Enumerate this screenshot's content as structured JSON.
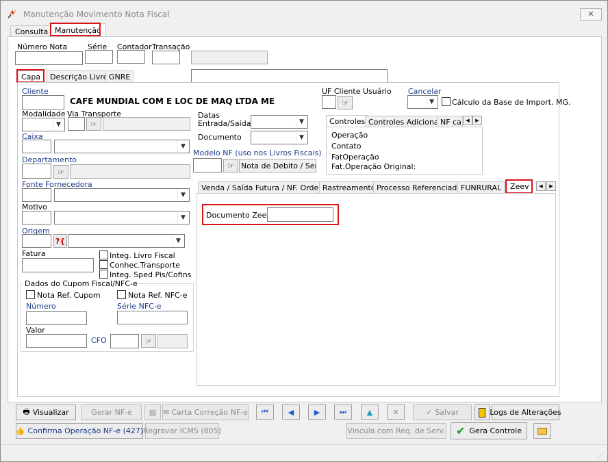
{
  "window": {
    "title": "Manutenção Movimento Nota Fiscal",
    "close": "✕"
  },
  "top_tabs": [
    "Consulta",
    "Manutenção"
  ],
  "header": {
    "numero_nota": "Número Nota",
    "serie": "Série",
    "contador": "Contador",
    "transacao": "Transação"
  },
  "sub_tabs": [
    "Capa",
    "Descrição Livre",
    "GNRE"
  ],
  "capa": {
    "cliente_label": "Cliente",
    "cliente_name": "CAFE MUNDIAL COM E LOC DE MAQ LTDA ME",
    "uf_label": "UF Cliente Usuário",
    "cancelar_label": "Cancelar",
    "calculo_label": "Cálculo da Base de Import. MG.",
    "modalidade": "Modalidade",
    "via_transporte": "Via Transporte",
    "datas": "Datas",
    "entrada_saida": "Entrada/Saída",
    "documento": "Documento",
    "caixa": "Caixa",
    "departamento": "Departamento",
    "modelo_nf": "Modelo NF (uso nos Livros Fiscais)",
    "modelo_value": "Nota de Debito / Sem In",
    "fonte_fornecedora": "Fonte Fornecedora",
    "motivo": "Motivo",
    "origem": "Origem",
    "fatura": "Fatura",
    "integ_livro": "Integ. Livro Fiscal",
    "conhec_transporte": "Conhec.Transporte",
    "integ_sped": "Integ. Sped Pis/Cofins",
    "cupom_group": "Dados do Cupom Fiscal/NFC-e",
    "nota_ref_cupom": "Nota Ref. Cupom",
    "nota_ref_nfce": "Nota Ref. NFC-e",
    "numero": "Número",
    "serie_nfce": "Série NFC-e",
    "valor": "Valor",
    "cfo": "CFO"
  },
  "controls_tabs": [
    "Controles",
    "Controles Adicionais",
    "NF ca"
  ],
  "controles_items": [
    "Operação",
    "Contato",
    "FatOperação",
    "Fat.Operação Original:"
  ],
  "lower_tabs": [
    "Venda / Saída Futura / NF. Ordem",
    "Rastreamento",
    "Processo Referenciado",
    "FUNRURAL",
    "Zeev"
  ],
  "zeev": {
    "documento_label": "Documento Zeev",
    "documento_value": ""
  },
  "buttons": {
    "visualizar": "Visualizar",
    "gerar_nfe": "Gerar NF-e",
    "carta_correcao": "Carta Correção NF-e",
    "salvar": "Salvar",
    "logs": "Logs de Alterações",
    "confirma": "Confirma Operação NF-e (427)",
    "regravar": "Regravar ICMS (805)",
    "vincula": "Vincula com Req. de Serv.",
    "gera_controle": "Gera Controle"
  },
  "colors": {
    "highlight": "#d9141b",
    "nav_blue": "#1d5fcf",
    "confirm_text": "#1a3a8a",
    "green_check": "#1a9a1a"
  }
}
